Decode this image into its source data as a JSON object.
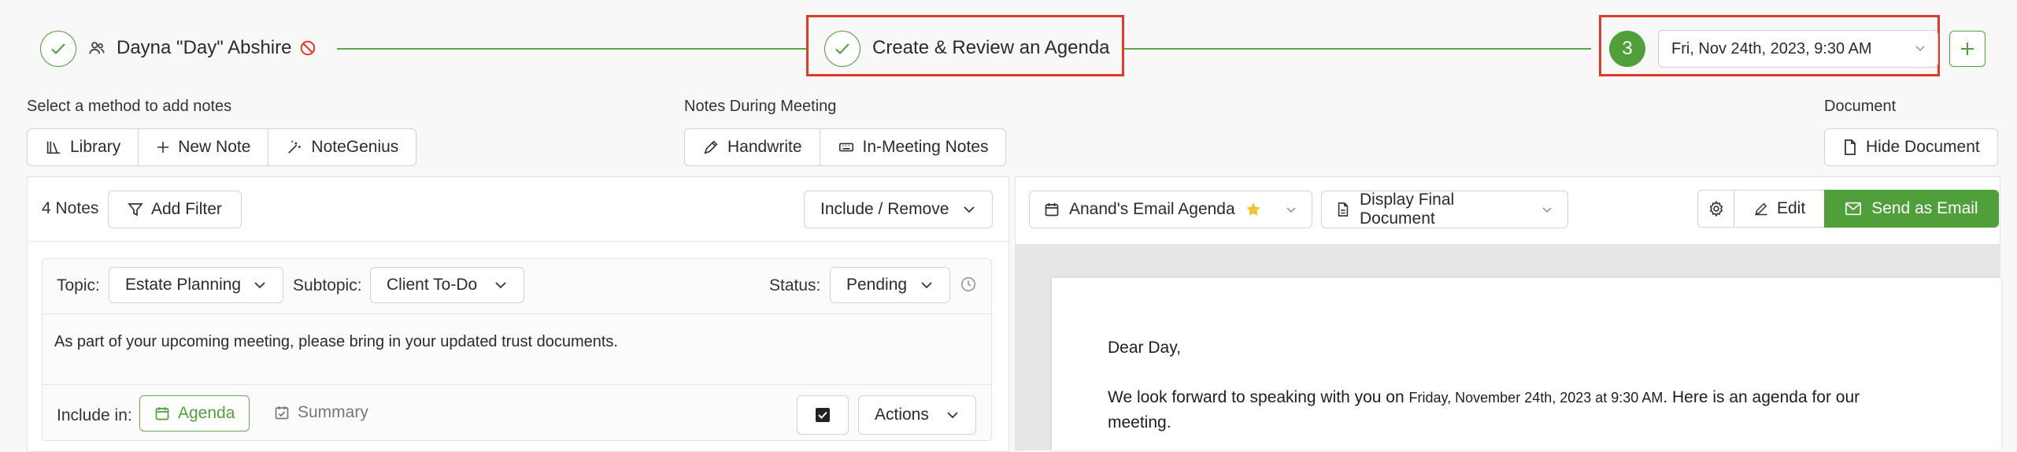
{
  "progress": {
    "client_name": "Dayna \"Day\" Abshire",
    "step_title": "Create & Review an Agenda",
    "step_number": "3",
    "meeting_date": "Fri, Nov 24th, 2023, 9:30 AM"
  },
  "add_notes": {
    "label": "Select a method to add notes",
    "buttons": [
      "Library",
      "New Note",
      "NoteGenius"
    ]
  },
  "during_meeting": {
    "label": "Notes During Meeting",
    "buttons": [
      "Handwrite",
      "In-Meeting Notes"
    ]
  },
  "document_section": {
    "label": "Document",
    "hide_button": "Hide Document"
  },
  "notes_panel": {
    "count": "4 Notes",
    "add_filter": "Add Filter",
    "include_remove": "Include / Remove",
    "note": {
      "topic_label": "Topic:",
      "topic_value": "Estate Planning",
      "subtopic_label": "Subtopic:",
      "subtopic_value": "Client To-Do",
      "status_label": "Status:",
      "status_value": "Pending",
      "text": "As part of your upcoming meeting, please bring in your updated trust documents.",
      "include_in_label": "Include in:",
      "agenda": "Agenda",
      "summary": "Summary",
      "actions": "Actions"
    }
  },
  "doc_panel": {
    "template": "Anand's Email Agenda",
    "display_mode": "Display Final Document",
    "edit": "Edit",
    "send": "Send as Email",
    "greeting": "Dear Day,",
    "body_start": "We look forward to speaking with you on ",
    "body_date": "Friday, November 24th, 2023 at 9:30 AM",
    "body_end": ". Here is an agenda for our",
    "body_line2": "meeting."
  },
  "colors": {
    "accent": "#4f9f3a",
    "highlight_box": "#e03a2a",
    "star": "#f2c12e"
  }
}
